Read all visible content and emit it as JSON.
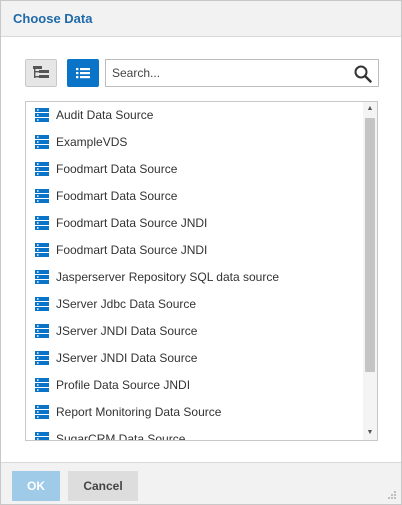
{
  "dialog": {
    "title": "Choose Data"
  },
  "toolbar": {
    "tree_view_icon": "tree-view-icon",
    "list_view_icon": "list-view-icon",
    "search_placeholder": "Search...",
    "search_icon": "magnifier-icon"
  },
  "list": {
    "item_icon": "data-source-icon",
    "items": [
      "Audit Data Source",
      "ExampleVDS",
      "Foodmart Data Source",
      "Foodmart Data Source",
      "Foodmart Data Source JNDI",
      "Foodmart Data Source JNDI",
      "Jasperserver Repository SQL data source",
      "JServer Jdbc Data Source",
      "JServer JNDI Data Source",
      "JServer JNDI Data Source",
      "Profile Data Source JNDI",
      "Report Monitoring Data Source",
      "SugarCRM Data Source"
    ]
  },
  "footer": {
    "ok_label": "OK",
    "cancel_label": "Cancel"
  },
  "colors": {
    "accent": "#0a74c9",
    "title": "#1f6aa8",
    "ok_disabled": "#9fcbe9"
  }
}
